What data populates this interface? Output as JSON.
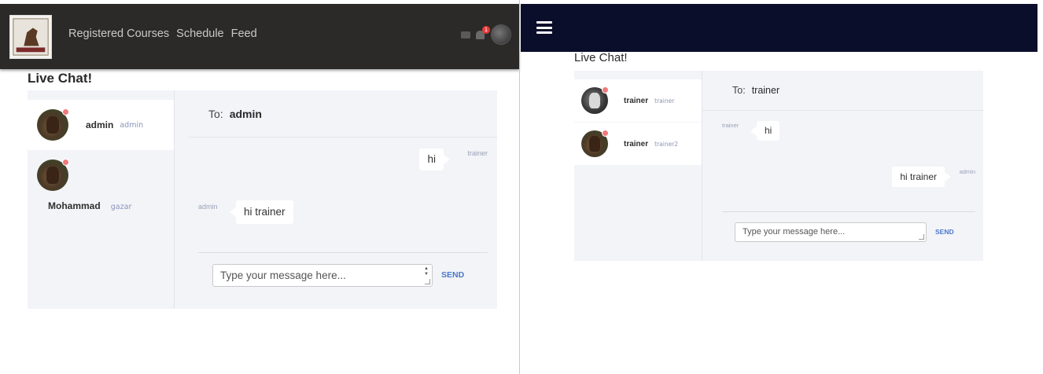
{
  "left": {
    "nav": [
      "Registered Courses",
      "Schedule",
      "Feed"
    ],
    "notification_count": "1",
    "page_title": "Live Chat!",
    "contacts": [
      {
        "name": "admin",
        "username": "admin"
      },
      {
        "name": "Mohammad",
        "username": "gazar"
      }
    ],
    "to_label": "To:",
    "to_name": "admin",
    "messages": [
      {
        "text": "hi",
        "sender": "trainer"
      },
      {
        "text": "hi trainer",
        "sender": "admin"
      }
    ],
    "input_placeholder": "Type your message here...",
    "send_label": "SEND"
  },
  "right": {
    "page_title": "Live Chat!",
    "contacts": [
      {
        "name": "trainer",
        "username": "trainer"
      },
      {
        "name": "trainer",
        "username": "trainer2"
      }
    ],
    "to_label": "To:",
    "to_name": "trainer",
    "messages": [
      {
        "text": "hi",
        "sender": "trainer"
      },
      {
        "text": "hi trainer",
        "sender": "admin"
      }
    ],
    "input_placeholder": "Type your message here...",
    "send_label": "SEND"
  },
  "colors": {
    "dark_header": "#2b2a28",
    "navy_header": "#0a0e2b",
    "panel_bg": "#f3f4f8",
    "send_accent": "#4a77c9",
    "online_dot": "#f07a7a",
    "badge": "#e83a3a"
  },
  "icons": [
    "logo-icon",
    "message-icon",
    "bell-icon",
    "user-avatar",
    "hamburger-menu-icon"
  ]
}
